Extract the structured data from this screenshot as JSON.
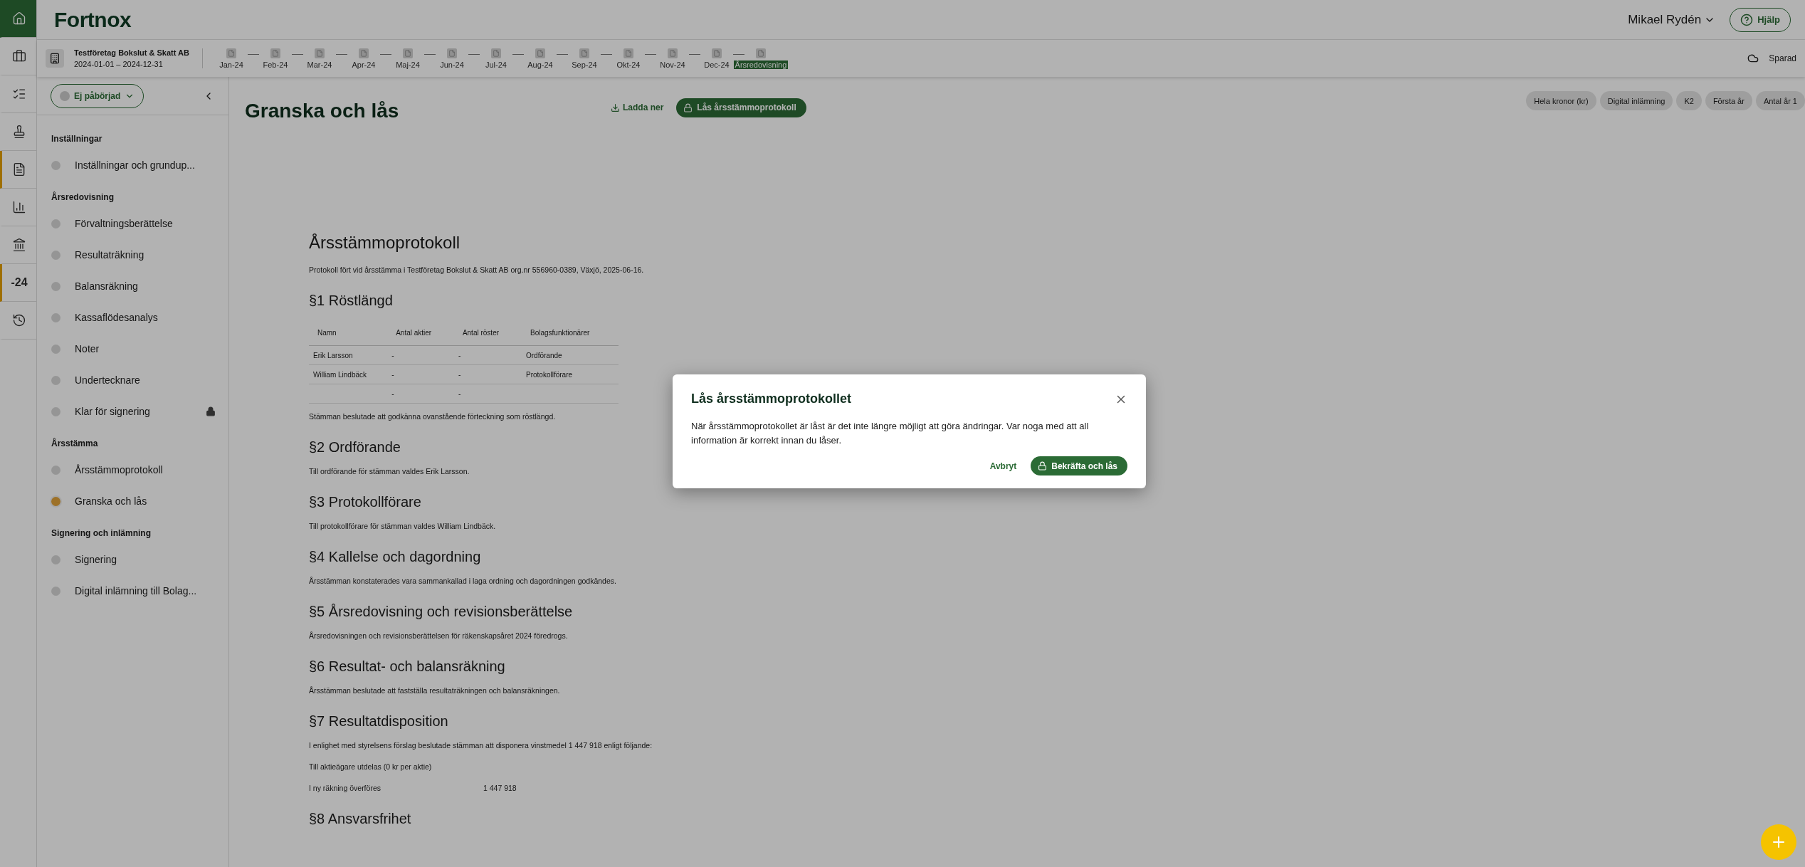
{
  "rail": [
    {
      "kind": "home",
      "selected": false
    },
    {
      "kind": "icon",
      "selected": false
    },
    {
      "kind": "icon",
      "selected": false
    },
    {
      "kind": "icon",
      "selected": false
    },
    {
      "kind": "icon",
      "selected": true
    },
    {
      "kind": "icon",
      "selected": false
    },
    {
      "kind": "icon",
      "selected": false
    },
    {
      "kind": "text",
      "label": "-24",
      "selected": true
    },
    {
      "kind": "icon",
      "selected": false
    }
  ],
  "header": {
    "logo": "Fortnox",
    "user": "Mikael Rydén",
    "help": "Hjälp"
  },
  "company": {
    "name": "Testföretag Bokslut & Skatt AB",
    "period": "2024-01-01 – 2024-12-31"
  },
  "periods": [
    {
      "label": "Jan-24",
      "selected": false
    },
    {
      "label": "Feb-24",
      "selected": false
    },
    {
      "label": "Mar-24",
      "selected": false
    },
    {
      "label": "Apr-24",
      "selected": false
    },
    {
      "label": "Maj-24",
      "selected": false
    },
    {
      "label": "Jun-24",
      "selected": false
    },
    {
      "label": "Jul-24",
      "selected": false
    },
    {
      "label": "Aug-24",
      "selected": false
    },
    {
      "label": "Sep-24",
      "selected": false
    },
    {
      "label": "Okt-24",
      "selected": false
    },
    {
      "label": "Nov-24",
      "selected": false
    },
    {
      "label": "Dec-24",
      "selected": false
    },
    {
      "label": "Årsredovisning",
      "selected": true
    }
  ],
  "save_status": "Sparad",
  "sidebar": {
    "status": "Ej påbörjad",
    "sections": [
      {
        "title": "Inställningar",
        "items": [
          {
            "label": "Inställningar och grundup...",
            "selected": false,
            "locked": false
          }
        ]
      },
      {
        "title": "Årsredovisning",
        "items": [
          {
            "label": "Förvaltningsberättelse",
            "selected": false,
            "locked": false
          },
          {
            "label": "Resultaträkning",
            "selected": false,
            "locked": false
          },
          {
            "label": "Balansräkning",
            "selected": false,
            "locked": false
          },
          {
            "label": "Kassaflödesanalys",
            "selected": false,
            "locked": false
          },
          {
            "label": "Noter",
            "selected": false,
            "locked": false
          },
          {
            "label": "Undertecknare",
            "selected": false,
            "locked": false
          },
          {
            "label": "Klar för signering",
            "selected": false,
            "locked": true
          }
        ]
      },
      {
        "title": "Årsstämma",
        "items": [
          {
            "label": "Årsstämmoprotokoll",
            "selected": false,
            "locked": false
          },
          {
            "label": "Granska och lås",
            "selected": true,
            "locked": false
          }
        ]
      },
      {
        "title": "Signering och inlämning",
        "items": [
          {
            "label": "Signering",
            "selected": false,
            "locked": false
          },
          {
            "label": "Digital inlämning till Bolag...",
            "selected": false,
            "locked": false
          }
        ]
      }
    ]
  },
  "page": {
    "title": "Granska och lås",
    "download": "Ladda ner",
    "lock": "Lås årsstämmoprotokoll"
  },
  "tags": [
    "Hela kronor (kr)",
    "Digital inlämning",
    "K2",
    "Första år",
    "Antal år 1"
  ],
  "document": {
    "title": "Årsstämmoprotokoll",
    "intro": "Protokoll fört vid årsstämma i Testföretag Bokslut & Skatt AB org.nr 556960-0389, Växjö, 2025-06-16.",
    "sections": [
      {
        "heading": "§1 Röstlängd",
        "blocks": [
          {
            "kind": "table",
            "columns": [
              "Namn",
              "Antal aktier",
              "Antal röster",
              "Bolagsfunktionärer"
            ],
            "rows": [
              {
                "cells": [
                  "Erik Larsson",
                  "-",
                  "-",
                  "Ordförande"
                ]
              },
              {
                "cells": [
                  "William Lindbäck",
                  "-",
                  "-",
                  "Protokollförare"
                ]
              },
              {
                "cells": [
                  null,
                  "-",
                  "-",
                  null
                ]
              }
            ]
          },
          {
            "kind": "text",
            "text": "Stämman beslutade att godkänna ovanstående förteckning som röstlängd."
          }
        ]
      },
      {
        "heading": "§2 Ordförande",
        "blocks": [
          {
            "kind": "text",
            "text": "Till ordförande för stämman valdes Erik Larsson."
          }
        ]
      },
      {
        "heading": "§3 Protokollförare",
        "blocks": [
          {
            "kind": "text",
            "text": "Till protokollförare för stämman valdes William Lindbäck."
          }
        ]
      },
      {
        "heading": "§4 Kallelse och dagordning",
        "blocks": [
          {
            "kind": "text",
            "text": "Årsstämman konstaterades vara sammankallad i laga ordning och dagordningen godkändes."
          }
        ]
      },
      {
        "heading": "§5 Årsredovisning och revisionsberättelse",
        "blocks": [
          {
            "kind": "text",
            "text": "Årsredovisningen och revisionsberättelsen för räkenskapsåret 2024 föredrogs."
          }
        ]
      },
      {
        "heading": "§6 Resultat- och balansräkning",
        "blocks": [
          {
            "kind": "text",
            "text": "Årsstämman beslutade att fastställa resultaträkningen och balansräkningen."
          }
        ]
      },
      {
        "heading": "§7 Resultatdisposition",
        "blocks": [
          {
            "kind": "text",
            "text": "I enlighet med styrelsens förslag beslutade stämman att disponera vinstmedel 1 447 918 enligt följande:"
          },
          {
            "kind": "text",
            "text": "Till aktieägare utdelas (0 kr per aktie)"
          },
          {
            "kind": "amount",
            "label": "I ny räkning överföres",
            "value": "1 447 918"
          }
        ]
      },
      {
        "heading": "§8 Ansvarsfrihet"
      }
    ]
  },
  "dialog": {
    "title": "Lås årsstämmoprotokollet",
    "body": "När årsstämmoprotokollet är låst är det inte längre möjligt att göra ändringar. Var noga med att all information är korrekt innan du låser.",
    "cancel": "Avbryt",
    "confirm": "Bekräfta och lås"
  }
}
